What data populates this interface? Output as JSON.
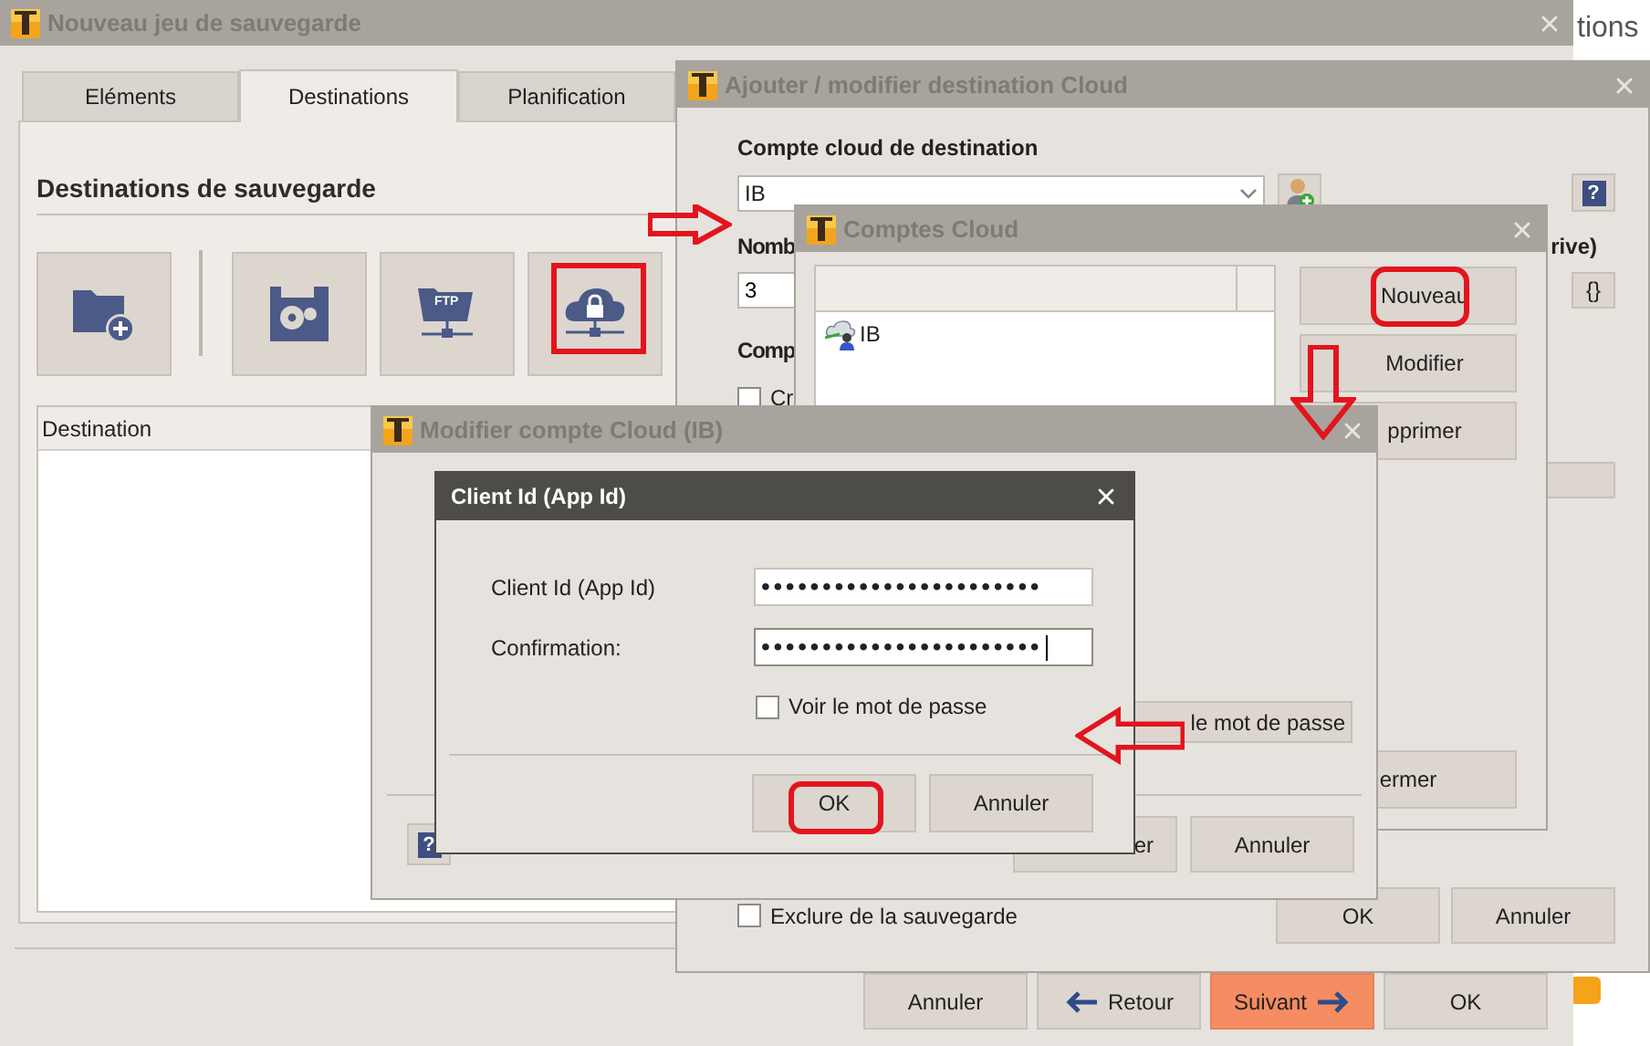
{
  "background_page": {
    "text": "tions"
  },
  "main_window": {
    "title": "Nouveau jeu de sauvegarde",
    "tabs": [
      {
        "label": "Eléments",
        "selected": false
      },
      {
        "label": "Destinations",
        "selected": true
      },
      {
        "label": "Planification",
        "selected": false
      }
    ],
    "section_title": "Destinations de sauvegarde",
    "destination_types": [
      {
        "kind": "folder",
        "highlighted": false
      },
      {
        "kind": "disk",
        "highlighted": false
      },
      {
        "kind": "ftp",
        "highlighted": false,
        "text": "FTP"
      },
      {
        "kind": "cloud",
        "highlighted": true
      }
    ],
    "list": {
      "columns": [
        "Destination"
      ]
    },
    "buttons": [
      {
        "label": "Annuler",
        "kind": "plain"
      },
      {
        "label": "Retour",
        "kind": "back"
      },
      {
        "label": "Suivant",
        "kind": "next"
      },
      {
        "label": "OK",
        "kind": "plain"
      }
    ]
  },
  "cloud_destination_dialog": {
    "title": "Ajouter / modifier destination Cloud",
    "account_label": "Compte cloud de destination",
    "account_value": "IB",
    "help": "?",
    "count_label": "Nomb",
    "count_label_end": "rive)",
    "count_value": "3",
    "variables_button": "{}",
    "compression_label": "Comp",
    "options": [
      {
        "label": "Cr",
        "checked": false
      }
    ],
    "exclude": {
      "label": "Exclure de la sauvegarde",
      "checked": false
    },
    "buttons": [
      "OK",
      "Annuler"
    ]
  },
  "cloud_accounts_dialog": {
    "title": "Comptes Cloud",
    "accounts": [
      {
        "name": "IB"
      }
    ],
    "buttons": [
      {
        "label": "Nouveau",
        "highlighted": true
      },
      {
        "label": "Modifier",
        "highlighted": false
      },
      {
        "label": "pprimer",
        "highlighted": false
      }
    ],
    "close_button": "ermer"
  },
  "edit_account_dialog": {
    "title": "Modifier compte Cloud (IB)",
    "password_button": "le mot de passe",
    "help": "?",
    "buttons": [
      "er",
      "Annuler"
    ]
  },
  "client_id_dialog": {
    "title": "Client Id (App Id)",
    "fields": [
      {
        "label": "Client Id (App Id)",
        "value": "•••••••••••••••••••••••",
        "focused": false
      },
      {
        "label": "Confirmation:",
        "value": "•••••••••••••••••••••••",
        "focused": true
      }
    ],
    "show_password": {
      "label": "Voir le mot de passe",
      "checked": false
    },
    "buttons": [
      {
        "label": "OK",
        "highlighted": true
      },
      {
        "label": "Annuler",
        "highlighted": false
      }
    ]
  }
}
